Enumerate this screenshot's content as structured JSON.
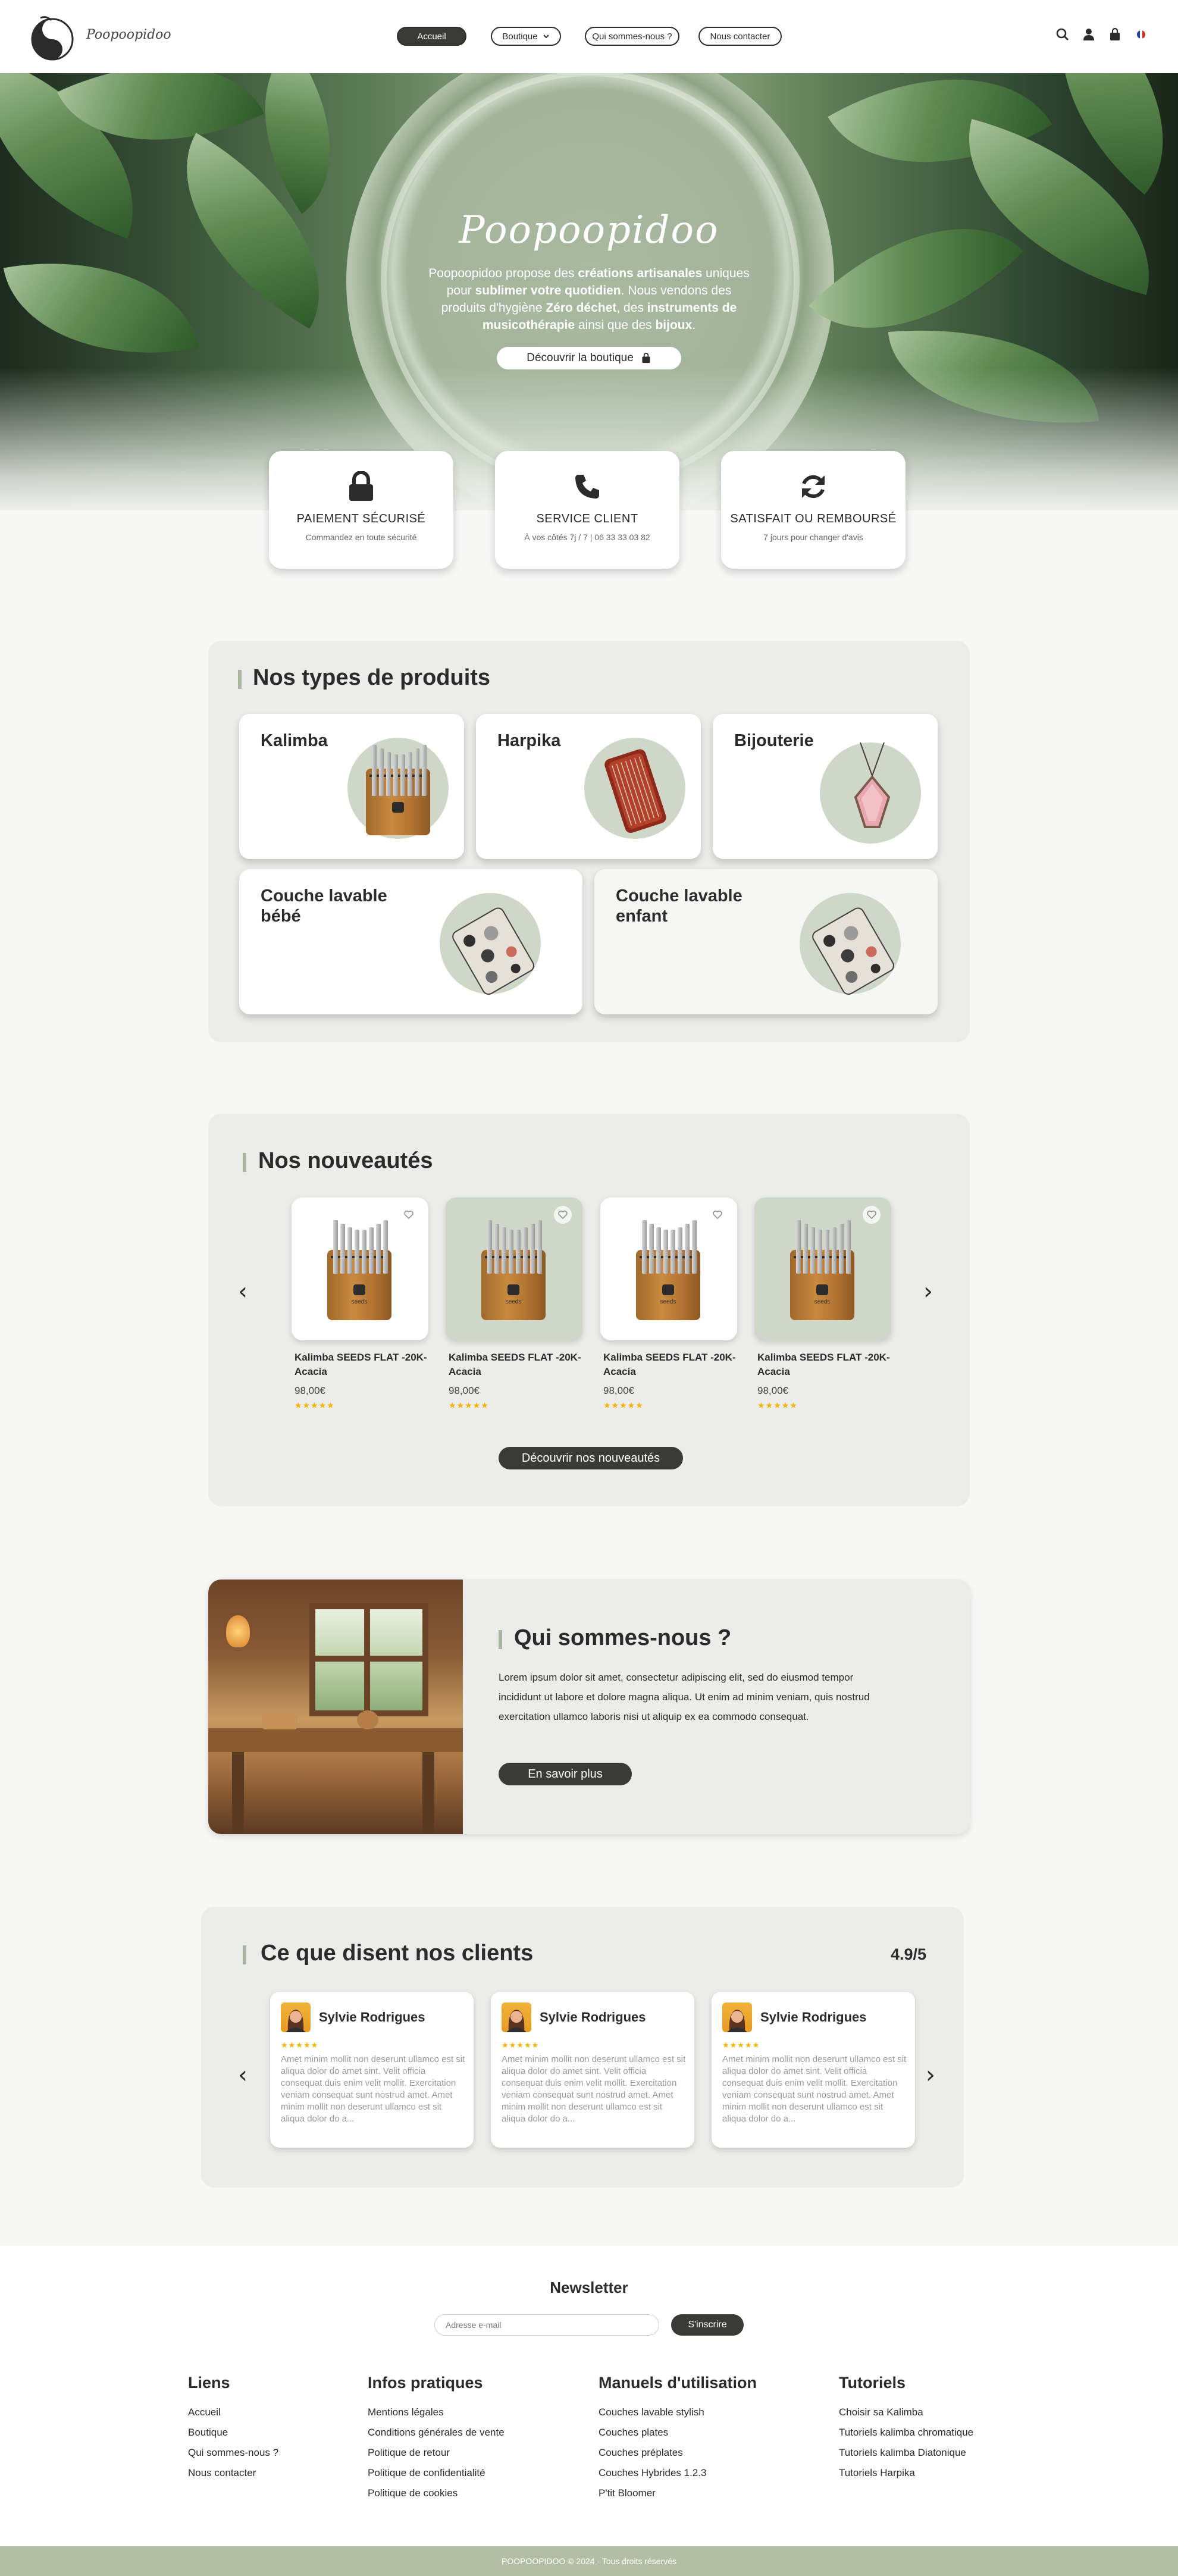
{
  "header": {
    "logo_text": "Poopoopidoo",
    "nav": [
      {
        "label": "Accueil",
        "active": true
      },
      {
        "label": "Boutique",
        "active": false
      },
      {
        "label": "Qui sommes-nous ?",
        "active": false
      },
      {
        "label": "Nous contacter",
        "active": false
      }
    ],
    "icons": [
      "search-icon",
      "user-icon",
      "bag-icon",
      "flag-fr-icon"
    ]
  },
  "hero": {
    "title": "Poopoopidoo",
    "desc_parts": [
      "Poopoopidoo propose des ",
      "créations artisanales",
      " uniques pour ",
      "sublimer votre quotidien",
      ". Nous vendons des produits d'hygiène ",
      "Zéro déchet",
      ", des ",
      "instruments de musicothérapie",
      " ainsi que des ",
      "bijoux",
      "."
    ],
    "button": "Découvrir la boutique"
  },
  "features": [
    {
      "icon": "lock-icon",
      "title": "PAIEMENT SÉCURISÉ",
      "subtitle": "Commandez en toute sécurité"
    },
    {
      "icon": "phone-icon",
      "title": "SERVICE CLIENT",
      "subtitle": "À vos côtés 7j / 7 | 06 33 33 03 82"
    },
    {
      "icon": "refresh-icon",
      "title": "SATISFAIT OU REMBOURSÉ",
      "subtitle": "7 jours pour changer d'avis"
    }
  ],
  "product_types": {
    "title": "Nos types de produits",
    "items": [
      {
        "label": "Kalimba"
      },
      {
        "label": "Harpika"
      },
      {
        "label": "Bijouterie"
      },
      {
        "label": "Couche lavable bébé"
      },
      {
        "label": "Couche lavable enfant"
      }
    ]
  },
  "novelties": {
    "title": "Nos nouveautés",
    "products": [
      {
        "name": "Kalimba SEEDS FLAT -20K- Acacia",
        "price": "98,00€",
        "rating": 5
      },
      {
        "name": "Kalimba SEEDS FLAT -20K- Acacia",
        "price": "98,00€",
        "rating": 5
      },
      {
        "name": "Kalimba SEEDS FLAT -20K- Acacia",
        "price": "98,00€",
        "rating": 5
      },
      {
        "name": "Kalimba SEEDS FLAT -20K- Acacia",
        "price": "98,00€",
        "rating": 5
      }
    ],
    "kalimba_brand": "seeds",
    "button": "Découvrir nos nouveautés",
    "stars": "★★★★★"
  },
  "about": {
    "title": "Qui sommes-nous ?",
    "text": "Lorem ipsum dolor sit amet, consectetur adipiscing elit, sed do eiusmod tempor incididunt ut labore et dolore magna aliqua. Ut enim ad minim veniam, quis nostrud exercitation ullamco laboris nisi ut aliquip ex ea commodo consequat.",
    "button": "En savoir plus"
  },
  "reviews": {
    "title": "Ce que disent nos clients",
    "score": "4.9/5",
    "items": [
      {
        "name": "Sylvie Rodrigues",
        "rating": 5,
        "text": "Amet minim mollit non deserunt ullamco est sit aliqua dolor do amet sint. Velit officia consequat duis enim velit mollit. Exercitation veniam consequat sunt nostrud amet. Amet minim mollit non deserunt ullamco est sit aliqua dolor do a..."
      },
      {
        "name": "Sylvie Rodrigues",
        "rating": 5,
        "text": "Amet minim mollit non deserunt ullamco est sit aliqua dolor do amet sint. Velit officia consequat duis enim velit mollit. Exercitation veniam consequat sunt nostrud amet. Amet minim mollit non deserunt ullamco est sit aliqua dolor do a..."
      },
      {
        "name": "Sylvie Rodrigues",
        "rating": 5,
        "text": "Amet minim mollit non deserunt ullamco est sit aliqua dolor do amet sint. Velit officia consequat duis enim velit mollit. Exercitation veniam consequat sunt nostrud amet. Amet minim mollit non deserunt ullamco est sit aliqua dolor do a..."
      }
    ],
    "stars": "★★★★★"
  },
  "newsletter": {
    "title": "Newsletter",
    "placeholder": "Adresse e-mail",
    "button": "S'inscrire"
  },
  "footer": {
    "columns": [
      {
        "title": "Liens",
        "links": [
          "Accueil",
          "Boutique",
          "Qui sommes-nous ?",
          "Nous contacter"
        ]
      },
      {
        "title": "Infos pratiques",
        "links": [
          "Mentions légales",
          "Conditions générales de vente",
          "Politique de retour",
          "Politique de confidentialité",
          "Politique de cookies"
        ]
      },
      {
        "title": "Manuels d'utilisation",
        "links": [
          "Couches lavable stylish",
          "Couches plates",
          "Couches préplates",
          "Couches Hybrides 1.2.3",
          "P'tit Bloomer"
        ]
      },
      {
        "title": "Tutoriels",
        "links": [
          "Choisir sa Kalimba",
          "Tutoriels kalimba chromatique",
          "Tutoriels kalimba Diatonique",
          "Tutoriels Harpika"
        ]
      }
    ],
    "copyright": "POOPOOPIDOO © 2024 - Tous droits réservés"
  },
  "colors": {
    "accent_dark": "#3a3a36",
    "sage": "#b2bfa4",
    "sage_light": "#cfd8c8",
    "star": "#f4b400"
  }
}
